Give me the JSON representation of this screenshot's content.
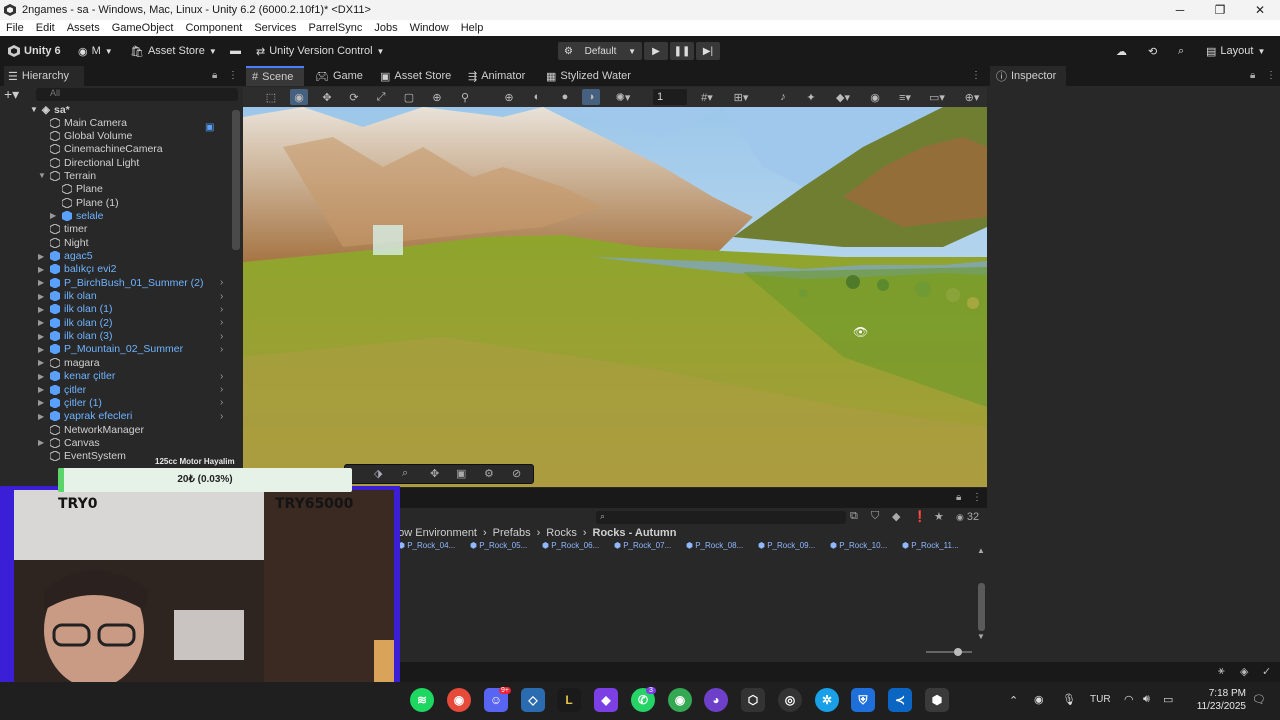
{
  "window": {
    "title": "2ngames - sa - Windows, Mac, Linux - Unity 6.2 (6000.2.10f1)* <DX11>",
    "min": "─",
    "max": "❐",
    "close": "✕"
  },
  "menu": [
    "File",
    "Edit",
    "Assets",
    "GameObject",
    "Component",
    "Services",
    "ParrelSync",
    "Jobs",
    "Window",
    "Help"
  ],
  "toolbar": {
    "unity": "Unity 6",
    "account": "M",
    "asset_store": "Asset Store",
    "version_control": "Unity Version Control",
    "build_profile": "Default",
    "layout": "Layout"
  },
  "hierarchy": {
    "tab": "Hierarchy",
    "search_placeholder": "All",
    "scene": "sa*",
    "items": [
      {
        "label": "Main Camera",
        "indent": 1,
        "prefab": false,
        "expand": "",
        "sub": false
      },
      {
        "label": "Global Volume",
        "indent": 1,
        "prefab": false,
        "expand": "",
        "sub": false
      },
      {
        "label": "CinemachineCamera",
        "indent": 1,
        "prefab": false,
        "expand": "",
        "sub": false
      },
      {
        "label": "Directional Light",
        "indent": 1,
        "prefab": false,
        "expand": "",
        "sub": false
      },
      {
        "label": "Terrain",
        "indent": 1,
        "prefab": false,
        "expand": "▼",
        "sub": false
      },
      {
        "label": "Plane",
        "indent": 2,
        "prefab": false,
        "expand": "",
        "sub": false
      },
      {
        "label": "Plane (1)",
        "indent": 2,
        "prefab": false,
        "expand": "",
        "sub": false
      },
      {
        "label": "selale",
        "indent": 2,
        "prefab": true,
        "expand": "▶",
        "sub": false
      },
      {
        "label": "timer",
        "indent": 1,
        "prefab": false,
        "expand": "",
        "sub": false
      },
      {
        "label": "Night",
        "indent": 1,
        "prefab": false,
        "expand": "",
        "sub": false
      },
      {
        "label": "agac5",
        "indent": 1,
        "prefab": true,
        "expand": "▶",
        "sub": false
      },
      {
        "label": "balıkçı evi2",
        "indent": 1,
        "prefab": true,
        "expand": "▶",
        "sub": false
      },
      {
        "label": "P_BirchBush_01_Summer (2)",
        "indent": 1,
        "prefab": true,
        "expand": "▶",
        "sub": true
      },
      {
        "label": "ilk olan",
        "indent": 1,
        "prefab": true,
        "expand": "▶",
        "sub": true
      },
      {
        "label": "ilk olan (1)",
        "indent": 1,
        "prefab": true,
        "expand": "▶",
        "sub": true
      },
      {
        "label": "ilk olan (2)",
        "indent": 1,
        "prefab": true,
        "expand": "▶",
        "sub": true
      },
      {
        "label": "ilk olan (3)",
        "indent": 1,
        "prefab": true,
        "expand": "▶",
        "sub": true
      },
      {
        "label": "P_Mountain_02_Summer",
        "indent": 1,
        "prefab": true,
        "expand": "▶",
        "sub": true
      },
      {
        "label": "magara",
        "indent": 1,
        "prefab": false,
        "expand": "▶",
        "sub": false
      },
      {
        "label": "kenar çitler",
        "indent": 1,
        "prefab": true,
        "expand": "▶",
        "sub": true
      },
      {
        "label": "çitler",
        "indent": 1,
        "prefab": true,
        "expand": "▶",
        "sub": true
      },
      {
        "label": "çitler (1)",
        "indent": 1,
        "prefab": true,
        "expand": "▶",
        "sub": true
      },
      {
        "label": "yaprak efecleri",
        "indent": 1,
        "prefab": true,
        "expand": "▶",
        "sub": true
      },
      {
        "label": "NetworkManager",
        "indent": 1,
        "prefab": false,
        "expand": "",
        "sub": false
      },
      {
        "label": "Canvas",
        "indent": 1,
        "prefab": false,
        "expand": "▶",
        "sub": false
      },
      {
        "label": "EventSystem",
        "indent": 1,
        "prefab": false,
        "expand": "",
        "sub": false
      }
    ]
  },
  "center_tabs": [
    "Scene",
    "Game",
    "Asset Store",
    "Animator",
    "Stylized Water"
  ],
  "scene_toolbar": {
    "grid_value": "1"
  },
  "inspector": {
    "tab": "Inspector"
  },
  "project": {
    "breadcrumb": [
      "dow Environment",
      "Prefabs",
      "Rocks",
      "Rocks - Autumn"
    ],
    "count": "32",
    "assets": [
      "P_Rock_04...",
      "P_Rock_05...",
      "P_Rock_06...",
      "P_Rock_07...",
      "P_Rock_08...",
      "P_Rock_09...",
      "P_Rock_10...",
      "P_Rock_11..."
    ]
  },
  "overlay": {
    "goal_title": "125cc Motor Hayalim",
    "progress_text": "20₺ (0.03%)",
    "progress_fraction": 0.0003,
    "min_label": "TRY0",
    "max_label": "TRY65000"
  },
  "taskbar": {
    "lang": "TUR",
    "time": "7:18 PM",
    "date": "11/23/2025",
    "badge_1": "3",
    "badge_2": "9+"
  }
}
